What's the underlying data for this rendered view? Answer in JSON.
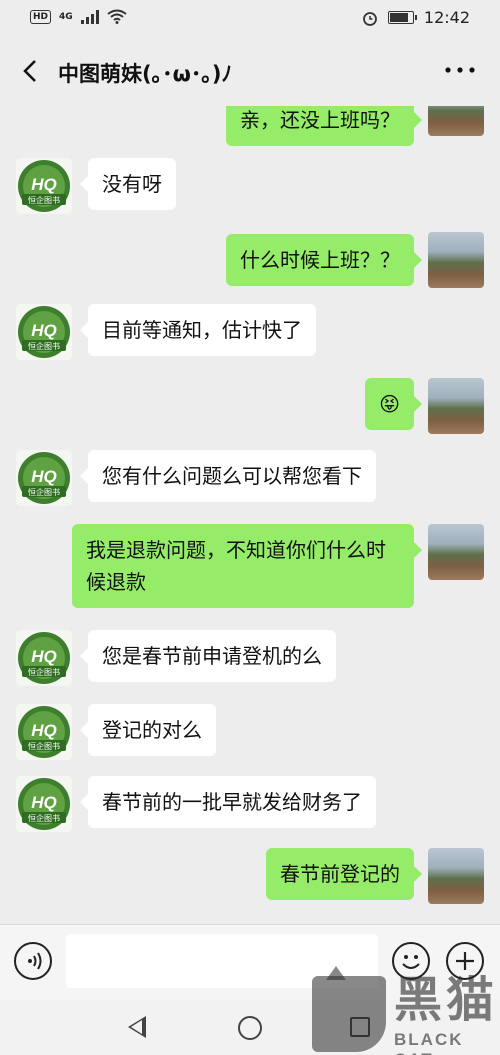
{
  "status_bar": {
    "hd": "HD",
    "network": "4G",
    "time": "12:42",
    "battery_level": 0.9
  },
  "header": {
    "back_icon": "chevron-left-icon",
    "title": "中图萌妹(｡･ω･｡)ﾉ",
    "more_icon": "more-dots-icon"
  },
  "messages": [
    {
      "from": "me",
      "text": "亲，还没上班吗？"
    },
    {
      "from": "contact",
      "text": "没有呀"
    },
    {
      "from": "me",
      "text": "什么时候上班？？"
    },
    {
      "from": "contact",
      "text": "目前等通知，估计快了"
    },
    {
      "from": "me",
      "text": "😝"
    },
    {
      "from": "contact",
      "text": "您有什么问题么可以帮您看下"
    },
    {
      "from": "me",
      "text": "我是退款问题，不知道你们什么时候退款"
    },
    {
      "from": "contact",
      "text": "您是春节前申请登机的么"
    },
    {
      "from": "contact",
      "text": "登记的对么"
    },
    {
      "from": "contact",
      "text": "春节前的一批早就发给财务了"
    },
    {
      "from": "me",
      "text": "春节前登记的"
    }
  ],
  "contact_avatar": {
    "letters": "HQ",
    "caption": "恒企图书"
  },
  "input_bar": {
    "voice_icon": "voice-icon",
    "emoji_icon": "emoji-icon",
    "plus_icon": "plus-icon",
    "placeholder": ""
  },
  "watermark": {
    "cn": "黑猫",
    "en": "BLACK CAT"
  },
  "colors": {
    "accent": "#95ec69",
    "background": "#ededed"
  }
}
